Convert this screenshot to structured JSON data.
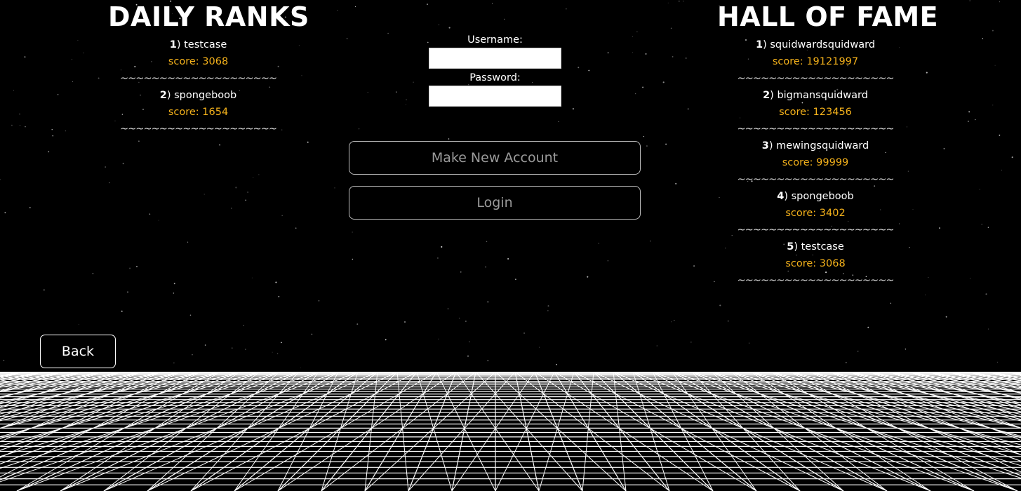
{
  "daily": {
    "title": "DAILY RANKS",
    "entries": [
      {
        "rank": "1",
        "name": "testcase",
        "score": "score: 3068"
      },
      {
        "rank": "2",
        "name": "spongeboob",
        "score": "score: 1654"
      }
    ]
  },
  "hall": {
    "title": "HALL OF FAME",
    "entries": [
      {
        "rank": "1",
        "name": "squidwardsquidward",
        "score": "score: 19121997"
      },
      {
        "rank": "2",
        "name": "bigmansquidward",
        "score": "score: 123456"
      },
      {
        "rank": "3",
        "name": "mewingsquidward",
        "score": "score: 99999"
      },
      {
        "rank": "4",
        "name": "spongeboob",
        "score": "score: 3402"
      },
      {
        "rank": "5",
        "name": "testcase",
        "score": "score: 3068"
      }
    ]
  },
  "separator": "~~~~~~~~~~~~~~~~~~~~",
  "rank_suffix": ")",
  "form": {
    "username_label": "Username:",
    "username_value": "",
    "password_label": "Password:",
    "password_value": ""
  },
  "buttons": {
    "new_account": "Make New Account",
    "login": "Login",
    "back": "Back"
  },
  "colors": {
    "background": "#000000",
    "score": "#f5b21b",
    "text": "#ffffff",
    "button_text": "#9a9a9a"
  }
}
